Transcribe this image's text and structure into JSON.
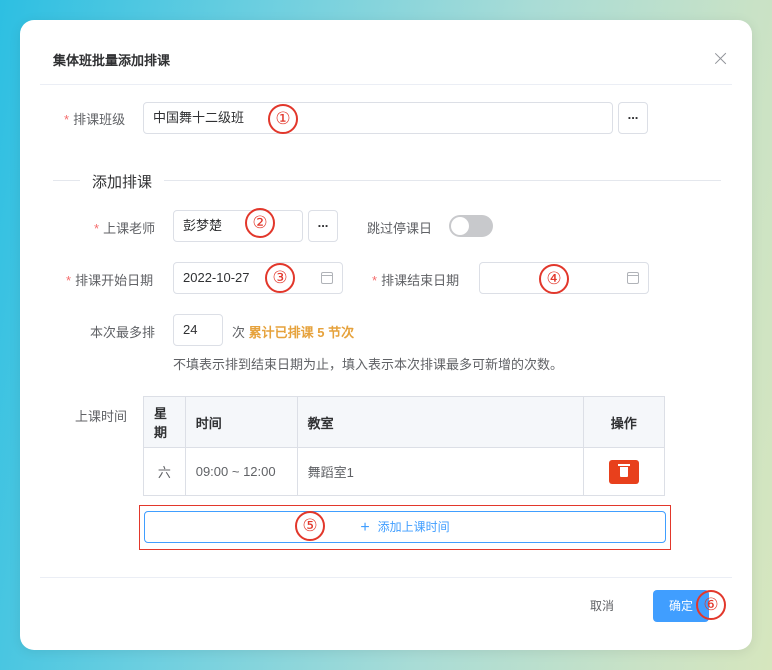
{
  "dialog": {
    "title": "集体班批量添加排课"
  },
  "form": {
    "class_label": "排课班级",
    "class_value": "中国舞十二级班",
    "dots": "...",
    "section_title": "添加排课",
    "teacher_label": "上课老师",
    "teacher_value": "彭梦楚",
    "skip_label": "跳过停课日",
    "start_label": "排课开始日期",
    "start_value": "2022-10-27",
    "end_label": "排课结束日期",
    "end_value": "",
    "max_label": "本次最多排",
    "max_value": "24",
    "max_unit": "次",
    "max_summary": "累计已排课 5 节次",
    "max_hint": "不填表示排到结束日期为止，填入表示本次排课最多可新增的次数。",
    "time_label": "上课时间",
    "required_mark": "*"
  },
  "table": {
    "headers": [
      "星期",
      "时间",
      "教室",
      "操作"
    ],
    "rows": [
      {
        "weekday": "六",
        "time": "09:00 ~ 12:00",
        "room": "舞蹈室1"
      }
    ]
  },
  "add_time": {
    "plus": "+",
    "label": "添加上课时间"
  },
  "footer": {
    "cancel": "取消",
    "ok": "确定"
  },
  "markers": [
    "①",
    "②",
    "③",
    "④",
    "⑤",
    "⑥"
  ]
}
